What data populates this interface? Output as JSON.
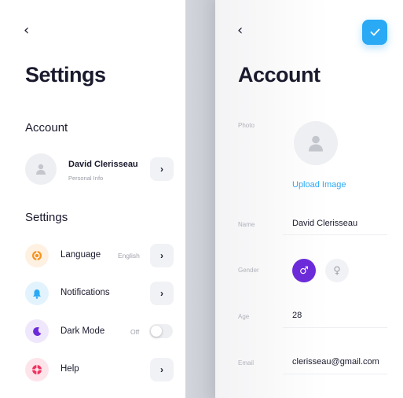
{
  "settings_panel": {
    "back_glyph": "‹",
    "title": "Settings",
    "account_section": "Account",
    "account": {
      "name": "David Clerisseau",
      "subtitle": "Personal Info"
    },
    "settings_section": "Settings",
    "rows": [
      {
        "label": "Language",
        "value": "English",
        "icon": "globe-icon",
        "color": "#f7931e"
      },
      {
        "label": "Notifications",
        "value": "",
        "icon": "bell-icon",
        "color": "#2aa9f5"
      },
      {
        "label": "Dark Mode",
        "value": "Off",
        "icon": "moon-icon",
        "color": "#6c2bd9"
      },
      {
        "label": "Help",
        "value": "",
        "icon": "lifebuoy-icon",
        "color": "#f0325f"
      }
    ],
    "chevron_glyph": "›",
    "dark_mode_on": false
  },
  "account_panel": {
    "back_glyph": "‹",
    "title": "Account",
    "photo_label": "Photo",
    "upload_label": "Upload Image",
    "fields": {
      "name": {
        "label": "Name",
        "value": "David Clerisseau"
      },
      "gender": {
        "label": "Gender",
        "selected": "male",
        "male_glyph": "♂",
        "female_glyph": "♀"
      },
      "age": {
        "label": "Age",
        "value": "28"
      },
      "email": {
        "label": "Email",
        "value": "clerisseau@gmail.com"
      }
    }
  },
  "colors": {
    "accent_blue": "#2aa9f5",
    "accent_purple": "#6c2bd9",
    "orange": "#f7931e",
    "pink": "#f0325f"
  }
}
